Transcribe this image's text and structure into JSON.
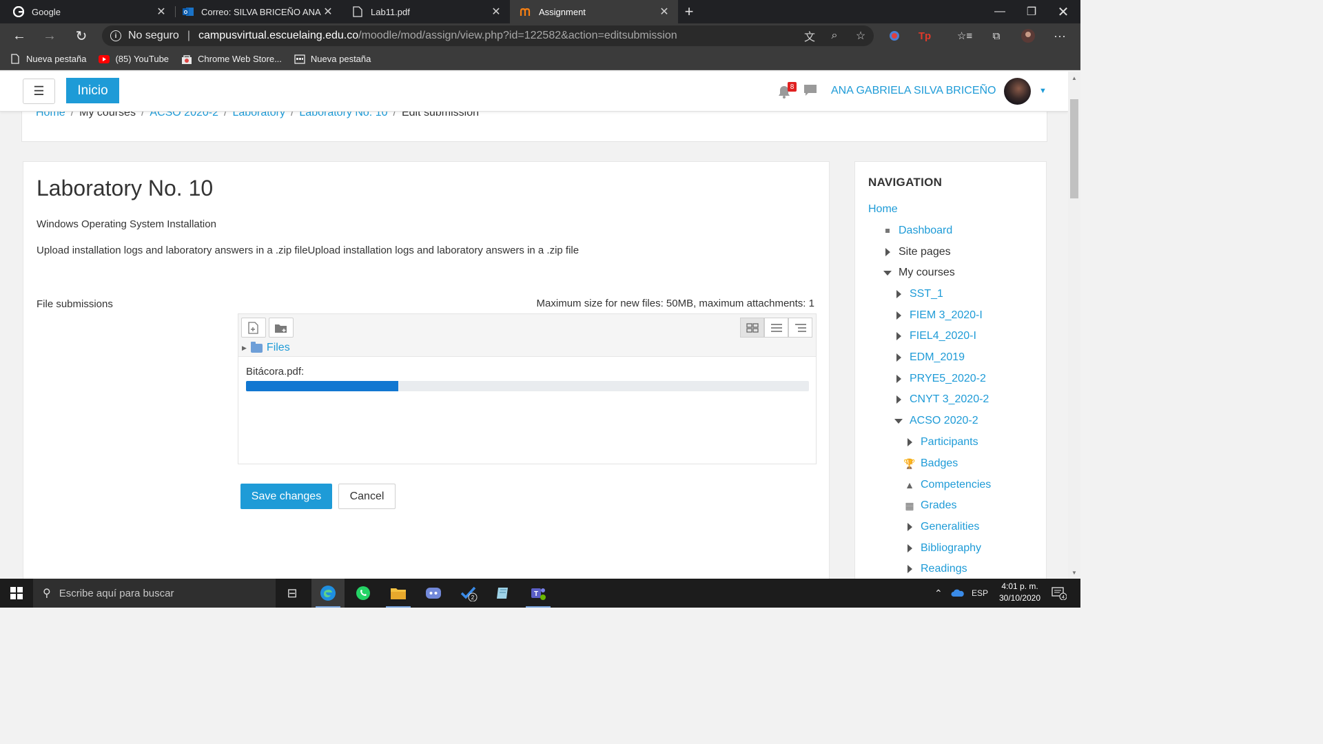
{
  "browser": {
    "tabs": [
      {
        "title": "Google",
        "active": false
      },
      {
        "title": "Correo: SILVA BRICEÑO ANA GA",
        "active": false
      },
      {
        "title": "Lab11.pdf",
        "active": false
      },
      {
        "title": "Assignment",
        "active": true
      }
    ],
    "security_label": "No seguro",
    "url_host": "campusvirtual.escuelaing.edu.co",
    "url_path": "/moodle/mod/assign/view.php?id=122582&action=editsubmission",
    "bookmarks": [
      "Nueva pestaña",
      "(85) YouTube",
      "Chrome Web Store...",
      "Nueva pestaña"
    ]
  },
  "site": {
    "home_button": "Inicio",
    "notification_count": "8",
    "user_name": "ANA GABRIELA SILVA BRICEÑO"
  },
  "breadcrumb": [
    "Home",
    "My courses",
    "ACSO 2020-2",
    "Laboratory",
    "Laboratory No. 10",
    "Edit submission"
  ],
  "assignment": {
    "title": "Laboratory No. 10",
    "subtitle": "Windows Operating System Installation",
    "description": "Upload installation logs and laboratory answers in a .zip fileUpload installation logs and laboratory answers in a .zip file",
    "file_submissions_label": "File submissions",
    "max_size_text": "Maximum size for new files: 50MB, maximum attachments: 1",
    "folder_label": "Files",
    "upload_file": "Bitácora.pdf:",
    "upload_progress": 0.27,
    "save_label": "Save changes",
    "cancel_label": "Cancel"
  },
  "navigation": {
    "heading": "NAVIGATION",
    "items": [
      {
        "label": "Home",
        "marker": "none",
        "link": true
      },
      {
        "label": "Dashboard",
        "marker": "square",
        "link": true
      },
      {
        "label": "Site pages",
        "marker": "collapsed",
        "link": false
      },
      {
        "label": "My courses",
        "marker": "expanded",
        "link": false
      },
      {
        "label": "SST_1",
        "marker": "collapsed",
        "link": true
      },
      {
        "label": "FIEM 3_2020-I",
        "marker": "collapsed",
        "link": true
      },
      {
        "label": "FIEL4_2020-I",
        "marker": "collapsed",
        "link": true
      },
      {
        "label": "EDM_2019",
        "marker": "collapsed",
        "link": true
      },
      {
        "label": "PRYE5_2020-2",
        "marker": "collapsed",
        "link": true
      },
      {
        "label": "CNYT 3_2020-2",
        "marker": "collapsed",
        "link": true
      },
      {
        "label": "ACSO 2020-2",
        "marker": "expanded",
        "link": true
      },
      {
        "label": "Participants",
        "marker": "collapsed",
        "link": true
      },
      {
        "label": "Badges",
        "marker": "trophy-icon",
        "link": true
      },
      {
        "label": "Competencies",
        "marker": "competencies-icon",
        "link": true
      },
      {
        "label": "Grades",
        "marker": "table-icon",
        "link": true
      },
      {
        "label": "Generalities",
        "marker": "collapsed",
        "link": true
      },
      {
        "label": "Bibliography",
        "marker": "collapsed",
        "link": true
      },
      {
        "label": "Readings",
        "marker": "collapsed",
        "link": true
      }
    ]
  },
  "taskbar": {
    "search_placeholder": "Escribe aquí para buscar",
    "language": "ESP",
    "time": "4:01 p. m.",
    "date": "30/10/2020",
    "todo_badge": "2",
    "notif_badge": "4"
  },
  "colors": {
    "accent": "#1e9bd7",
    "progress": "#1177d1",
    "badge": "#e02020"
  }
}
